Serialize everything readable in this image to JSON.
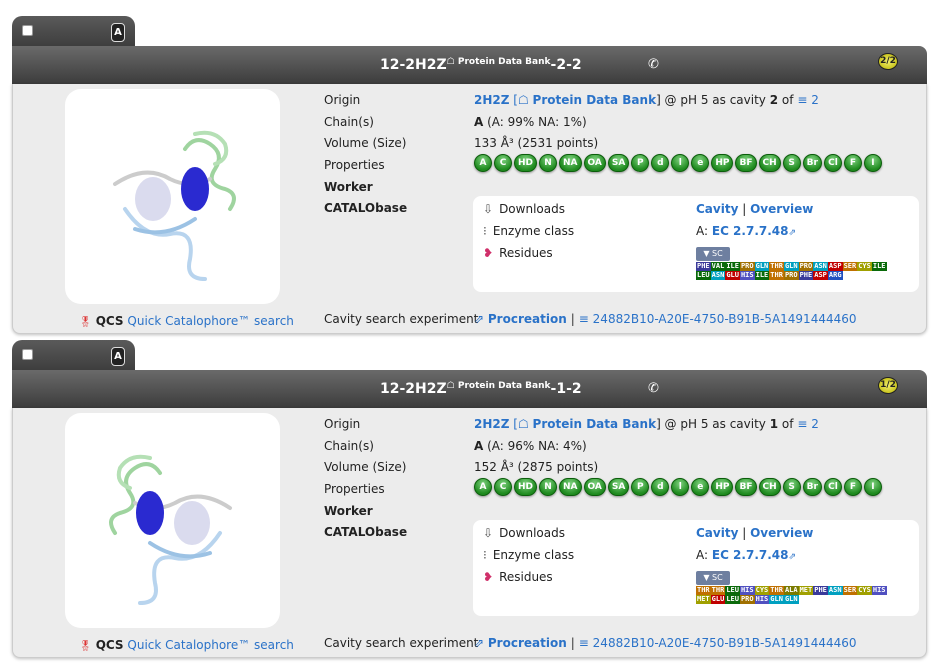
{
  "cards": [
    {
      "title": "12-2H2Z",
      "title_sup": "Protein Data Bank",
      "title_suffix": "-2-2",
      "count": "2/2",
      "tab_letter": "A",
      "origin_id": "2H2Z",
      "origin_bracket_open": "[",
      "origin_db": "Protein Data Bank",
      "origin_rest": "] @ pH 5 as cavity",
      "cavity_no": "2",
      "of_text": "of",
      "cavity_total": "2",
      "chain": "A",
      "chain_rest": "(A: 99% NA: 1%)",
      "volume": "133 Å³ (2531 points)",
      "properties": [
        "A",
        "C",
        "HD",
        "N",
        "NA",
        "OA",
        "SA",
        "P",
        "d",
        "l",
        "e",
        "HP",
        "BF",
        "CH",
        "S",
        "Br",
        "Cl",
        "F",
        "I"
      ],
      "residues": [
        [
          "PHE",
          "#3a3a9a"
        ],
        [
          "VAL",
          "#0a6a0a"
        ],
        [
          "ILE",
          "#0a6a0a"
        ],
        [
          "PRO",
          "#a07000"
        ],
        [
          "GLN",
          "#00a0c0"
        ],
        [
          "THR",
          "#c07000"
        ],
        [
          "GLN",
          "#00a0c0"
        ],
        [
          "PRO",
          "#a07000"
        ],
        [
          "ASN",
          "#00a0c0"
        ],
        [
          "ASP",
          "#c00000"
        ],
        [
          "SER",
          "#c07000"
        ],
        [
          "CYS",
          "#a0a000"
        ],
        [
          "ILE",
          "#0a6a0a"
        ],
        [
          "LEU",
          "#0a6a0a"
        ],
        [
          "ASN",
          "#00a0c0"
        ],
        [
          "GLU",
          "#c00000"
        ],
        [
          "HIS",
          "#5050c0"
        ],
        [
          "ILE",
          "#0a6a0a"
        ],
        [
          "THR",
          "#c07000"
        ],
        [
          "PRO",
          "#a07000"
        ],
        [
          "PHE",
          "#3a3a9a"
        ],
        [
          "ASP",
          "#c00000"
        ],
        [
          "ARG",
          "#2050c0"
        ]
      ],
      "uuid": "24882B10-A20E-4750-B91B-5A1491444460"
    },
    {
      "title": "12-2H2Z",
      "title_sup": "Protein Data Bank",
      "title_suffix": "-1-2",
      "count": "1/2",
      "tab_letter": "A",
      "origin_id": "2H2Z",
      "origin_bracket_open": "[",
      "origin_db": "Protein Data Bank",
      "origin_rest": "] @ pH 5 as cavity",
      "cavity_no": "1",
      "of_text": "of",
      "cavity_total": "2",
      "chain": "A",
      "chain_rest": "(A: 96% NA: 4%)",
      "volume": "152 Å³ (2875 points)",
      "properties": [
        "A",
        "C",
        "HD",
        "N",
        "NA",
        "OA",
        "SA",
        "P",
        "d",
        "l",
        "e",
        "HP",
        "BF",
        "CH",
        "S",
        "Br",
        "Cl",
        "F",
        "I"
      ],
      "residues": [
        [
          "THR",
          "#c07000"
        ],
        [
          "THR",
          "#c07000"
        ],
        [
          "LEU",
          "#0a6a0a"
        ],
        [
          "HIS",
          "#5050c0"
        ],
        [
          "CYS",
          "#a0a000"
        ],
        [
          "THR",
          "#c07000"
        ],
        [
          "ALA",
          "#7a7a00"
        ],
        [
          "MET",
          "#a0a000"
        ],
        [
          "PHE",
          "#3a3a9a"
        ],
        [
          "ASN",
          "#00a0c0"
        ],
        [
          "SER",
          "#c07000"
        ],
        [
          "CYS",
          "#a0a000"
        ],
        [
          "HIS",
          "#5050c0"
        ],
        [
          "MET",
          "#a0a000"
        ],
        [
          "GLU",
          "#c00000"
        ],
        [
          "LEU",
          "#0a6a0a"
        ],
        [
          "PRO",
          "#a07000"
        ],
        [
          "HIS",
          "#5050c0"
        ],
        [
          "GLN",
          "#00a0c0"
        ],
        [
          "GLN",
          "#00a0c0"
        ]
      ],
      "uuid": "24882B10-A20E-4750-B91B-5A1491444460"
    }
  ],
  "labels": {
    "origin": "Origin",
    "chains": "Chain(s)",
    "volume": "Volume (Size)",
    "properties": "Properties",
    "worker": "Worker",
    "catalobase": "CATALObase",
    "cavity_search": "Cavity search experiment"
  },
  "cat": {
    "downloads": "Downloads",
    "cavity": "Cavity",
    "pipe": "|",
    "overview": "Overview",
    "enzyme": "Enzyme class",
    "ec_prefix": "A:",
    "ec": "EC 2.7.7.48",
    "residues": "Residues",
    "sc": "▼ SC"
  },
  "procreation": "Procreation",
  "qcs": {
    "label": "QCS",
    "link": "Quick Catalophore™ search"
  },
  "colors": {
    "link": "#2a72c8",
    "pill": "#1f8a1f",
    "header": "#4a4a4a",
    "cavity_blue": "#2a2ad0"
  }
}
